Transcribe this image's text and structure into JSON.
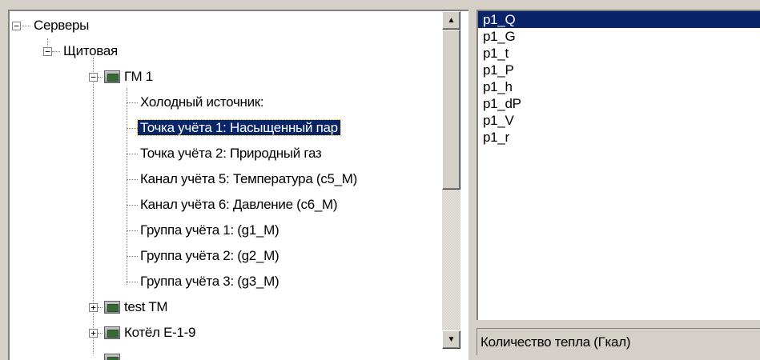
{
  "tree": {
    "nodes": [
      {
        "label": "Серверы",
        "expander": "−"
      },
      {
        "label": "Щитовая",
        "expander": "−"
      },
      {
        "label": "ГМ 1",
        "expander": "−"
      },
      {
        "label": "Холодный источник:"
      },
      {
        "label": "Точка учёта 1: Насыщенный пар",
        "selected": true
      },
      {
        "label": "Точка учёта 2: Природный газ"
      },
      {
        "label": "Канал учёта 5: Температура  (c5_M)"
      },
      {
        "label": "Канал учёта 6: Давление  (c6_M)"
      },
      {
        "label": "Группа учёта 1:   (g1_M)"
      },
      {
        "label": "Группа учёта 2:   (g2_M)"
      },
      {
        "label": "Группа учёта 3:   (g3_M)"
      },
      {
        "label": "test TM",
        "expander": "+"
      },
      {
        "label": "Котёл Е-1-9",
        "expander": "+"
      }
    ],
    "scroll_up": "▲",
    "scroll_down": "▼"
  },
  "params_list": {
    "items": [
      "p1_Q",
      "p1_G",
      "p1_t",
      "p1_P",
      "p1_h",
      "p1_dP",
      "p1_V",
      "p1_r"
    ],
    "selected_index": 0
  },
  "status": {
    "description": "Количество тепла (Гкал)"
  },
  "colors": {
    "selection": "#0a246a",
    "window_bg": "#d4d0c8"
  }
}
